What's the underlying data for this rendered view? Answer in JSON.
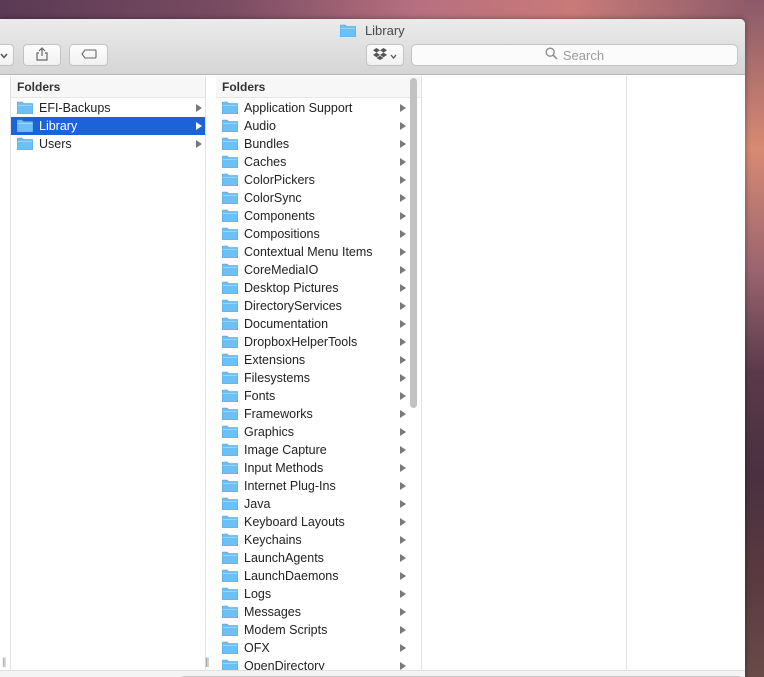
{
  "window": {
    "title": "Library"
  },
  "toolbar": {
    "search_placeholder": "Search"
  },
  "column1": {
    "header": "Folders",
    "items": [
      {
        "label": "EFI-Backups",
        "selected": false
      },
      {
        "label": "Library",
        "selected": true
      },
      {
        "label": "Users",
        "selected": false
      }
    ]
  },
  "column2": {
    "header": "Folders",
    "items": [
      "Application Support",
      "Audio",
      "Bundles",
      "Caches",
      "ColorPickers",
      "ColorSync",
      "Components",
      "Compositions",
      "Contextual Menu Items",
      "CoreMediaIO",
      "Desktop Pictures",
      "DirectoryServices",
      "Documentation",
      "DropboxHelperTools",
      "Extensions",
      "Filesystems",
      "Fonts",
      "Frameworks",
      "Graphics",
      "Image Capture",
      "Input Methods",
      "Internet Plug-Ins",
      "Java",
      "Keyboard Layouts",
      "Keychains",
      "LaunchAgents",
      "LaunchDaemons",
      "Logs",
      "Messages",
      "Modem Scripts",
      "OFX",
      "OpenDirectory"
    ]
  },
  "colors": {
    "selection": "#1a63d8",
    "folder": "#6cc0f5"
  }
}
